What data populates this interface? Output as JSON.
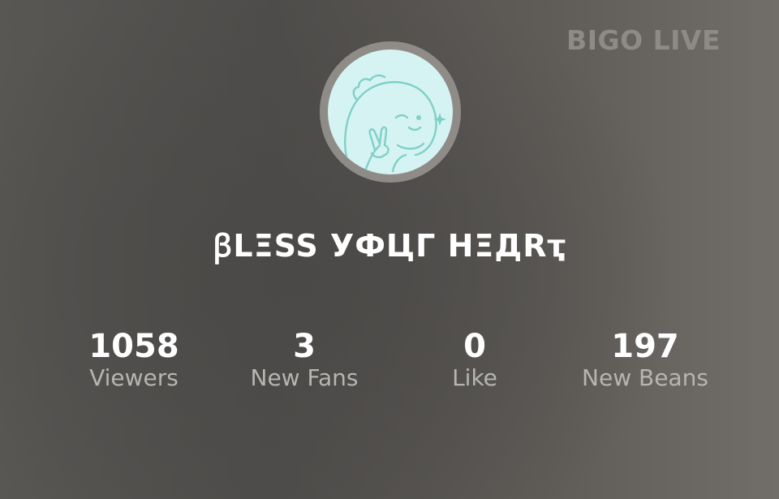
{
  "header": {
    "brand": "BIGO LIVE"
  },
  "profile": {
    "avatar_icon": "mascot-avatar-icon",
    "username": "ꞵLΞSS УФЦГ HΞДRҭ"
  },
  "stats": [
    {
      "value": "1058",
      "label": "Viewers"
    },
    {
      "value": "3",
      "label": "New Fans"
    },
    {
      "value": "0",
      "label": "Like"
    },
    {
      "value": "197",
      "label": "New Beans"
    }
  ],
  "colors": {
    "avatar_bg": "#d6f3f3",
    "avatar_line": "#7fd0c8",
    "ring": "#8f8c88",
    "label": "#b7b5b2"
  }
}
